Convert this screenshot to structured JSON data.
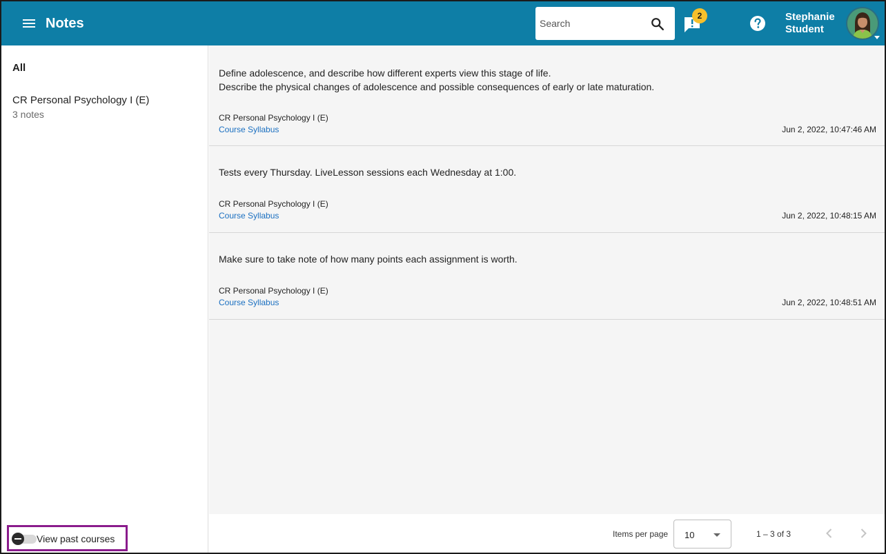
{
  "header": {
    "title": "Notes",
    "menu_icon": "menu-icon",
    "search_placeholder": "Search",
    "search_icon": "search-icon",
    "alerts_icon": "feedback-alert-icon",
    "alerts_count": "2",
    "help_icon": "help-circle-icon",
    "user_first": "Stephanie",
    "user_last": "Student",
    "accent_color": "#0e7ea6",
    "badge_color": "#f6c02b"
  },
  "sidebar": {
    "all_label": "All",
    "courses": [
      {
        "title": "CR Personal Psychology I (E)",
        "count": "3 notes"
      }
    ],
    "past_courses_label": "View past courses",
    "past_courses_on": false
  },
  "notes": [
    {
      "lines": [
        "Define adolescence, and describe how different experts view this stage of life.",
        "Describe the physical changes of adolescence and possible consequences of early or late maturation."
      ],
      "course": "CR Personal Psychology I (E)",
      "link": "Course Syllabus",
      "date": "Jun 2, 2022, 10:47:46 AM"
    },
    {
      "lines": [
        "Tests every Thursday. LiveLesson sessions each Wednesday at 1:00."
      ],
      "course": "CR Personal Psychology I (E)",
      "link": "Course Syllabus",
      "date": "Jun 2, 2022, 10:48:15 AM"
    },
    {
      "lines": [
        "Make sure to take note of how many points each assignment is worth."
      ],
      "course": "CR Personal Psychology I (E)",
      "link": "Course Syllabus",
      "date": "Jun 2, 2022, 10:48:51 AM"
    }
  ],
  "pagination": {
    "items_per_page_label": "Items per page",
    "items_per_page": "10",
    "range": "1 – 3 of 3",
    "prev_icon": "chevron-left-icon",
    "next_icon": "chevron-right-icon"
  }
}
